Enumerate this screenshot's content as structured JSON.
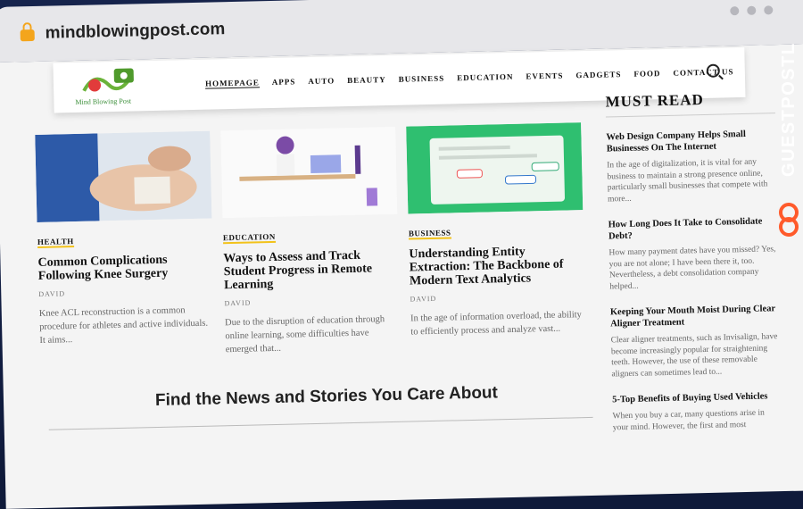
{
  "browser": {
    "url": "mindblowingpost.com"
  },
  "site": {
    "logo_text": "Mind Blowing Post",
    "nav": [
      "HOMEPAGE",
      "APPS",
      "AUTO",
      "BEAUTY",
      "BUSINESS",
      "EDUCATION",
      "EVENTS",
      "GADGETS",
      "FOOD",
      "CONTACT US"
    ]
  },
  "articles": [
    {
      "category": "HEALTH",
      "title": "Common Complications Following Knee Surgery",
      "author": "DAVID",
      "excerpt": "Knee ACL reconstruction is a common procedure for athletes and active individuals. It aims..."
    },
    {
      "category": "EDUCATION",
      "title": "Ways to Assess and Track Student Progress in Remote Learning",
      "author": "DAVID",
      "excerpt": "Due to the disruption of education through online learning, some difficulties have emerged that..."
    },
    {
      "category": "BUSINESS",
      "title": "Understanding Entity Extraction: The Backbone of Modern Text Analytics",
      "author": "DAVID",
      "excerpt": "In the age of information overload, the ability to efficiently process and analyze vast..."
    }
  ],
  "sidebar": {
    "heading": "MUST READ",
    "items": [
      {
        "title": "Web Design Company Helps Small Businesses On The Internet",
        "excerpt": "In the age of digitalization, it is vital for any business to maintain a strong presence online, particularly small businesses that compete with more..."
      },
      {
        "title": "How Long Does It Take to Consolidate Debt?",
        "excerpt": "How many payment dates have you missed? Yes, you are not alone; I have been there it, too. Nevertheless, a debt consolidation company helped..."
      },
      {
        "title": "Keeping Your Mouth Moist During Clear Aligner Treatment",
        "excerpt": "Clear aligner treatments, such as Invisalign, have become increasingly popular for straightening teeth. However, the use of these removable aligners can sometimes lead to..."
      },
      {
        "title": "5-Top Benefits of Buying Used Vehicles",
        "excerpt": "When you buy a car, many questions arise in your mind. However, the first and most"
      }
    ]
  },
  "section": {
    "heading": "Find the News and Stories You Care About"
  },
  "brand": {
    "text": "GUESTPOSTLINKS"
  }
}
